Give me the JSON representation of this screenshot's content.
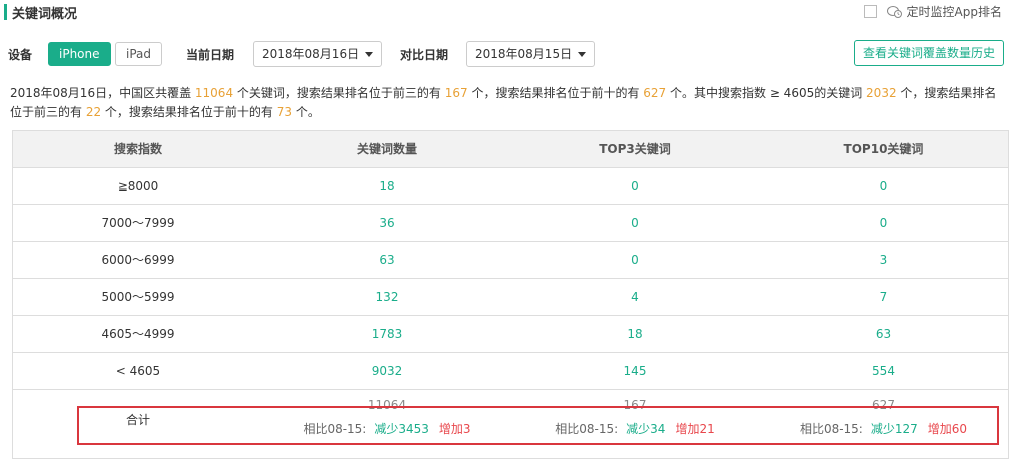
{
  "header": {
    "title": "关键词概况",
    "monitor_label": "定时监控App排名"
  },
  "controls": {
    "device_label": "设备",
    "devices": [
      "iPhone",
      "iPad"
    ],
    "active_device": "iPhone",
    "current_date_label": "当前日期",
    "current_date": "2018年08月16日",
    "compare_date_label": "对比日期",
    "compare_date": "2018年08月15日",
    "history_button": "查看关键词覆盖数量历史"
  },
  "summary": {
    "p1": "2018年08月16日，中国区共覆盖 ",
    "total": "11064",
    "p2": " 个关键词，搜索结果排名位于前三的有 ",
    "top3": "167",
    "p3": " 个，搜索结果排名位于前十的有 ",
    "top10": "627",
    "p4": " 个。其中搜索指数 ≥ 4605的关键词 ",
    "high": "2032",
    "p5": " 个，搜索结果排名位于前三的有 ",
    "high_top3": "22",
    "p6": " 个，搜索结果排名位于前十的有 ",
    "high_top10": "73",
    "p7": " 个。"
  },
  "table": {
    "headers": [
      "搜索指数",
      "关键词数量",
      "TOP3关键词",
      "TOP10关键词"
    ],
    "rows": [
      [
        "≧8000",
        "18",
        "0",
        "0"
      ],
      [
        "7000～7999",
        "36",
        "0",
        "0"
      ],
      [
        "6000～6999",
        "63",
        "0",
        "3"
      ],
      [
        "5000～5999",
        "132",
        "4",
        "7"
      ],
      [
        "4605～4999",
        "1783",
        "18",
        "63"
      ],
      [
        "< 4605",
        "9032",
        "145",
        "554"
      ]
    ],
    "total": {
      "label": "合计",
      "values": [
        "11064",
        "167",
        "627"
      ],
      "compare_prefix": "相比08-15:",
      "decrease": [
        "减少3453",
        "减少34",
        "减少127"
      ],
      "increase": [
        "增加3",
        "增加21",
        "增加60"
      ]
    }
  },
  "colors": {
    "accent": "#1aad8a",
    "highlight_num": "#e8a136",
    "increase": "#e8474c",
    "annotation_box": "#d9363e"
  }
}
